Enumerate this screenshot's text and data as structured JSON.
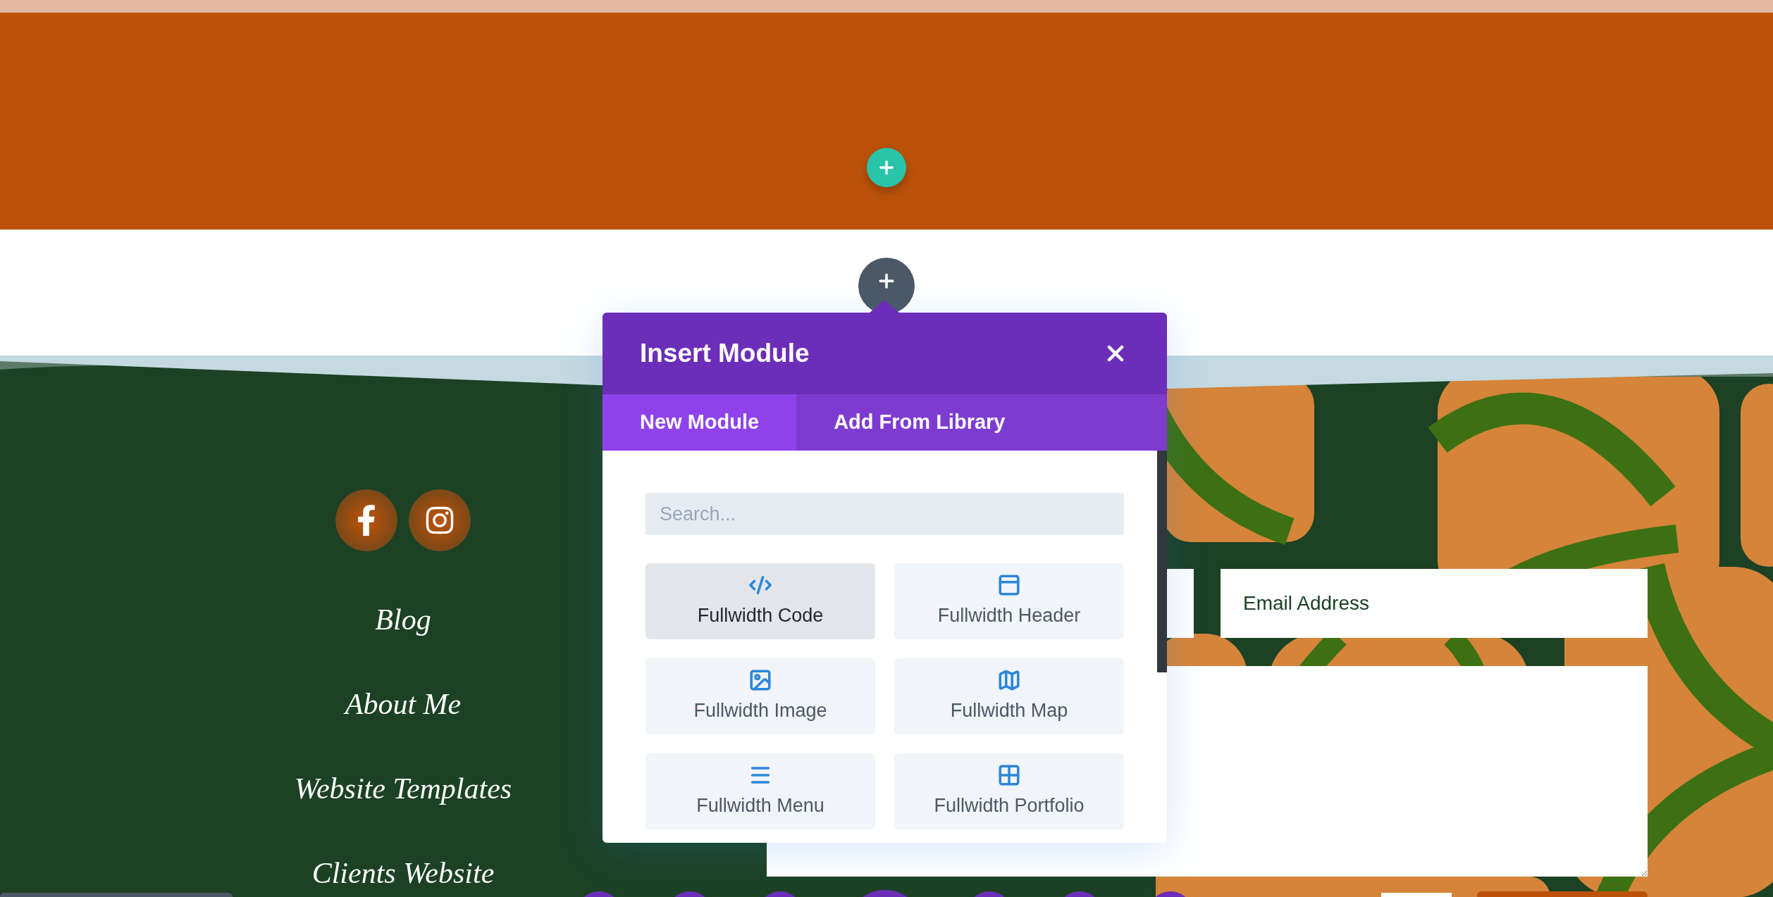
{
  "add_buttons": [
    {
      "kind": "section"
    },
    {
      "kind": "row"
    }
  ],
  "footer": {
    "social": [
      {
        "kind": "facebook"
      },
      {
        "kind": "instagram"
      }
    ],
    "nav": [
      "Blog",
      "About Me",
      "Website Templates",
      "Clients Website"
    ],
    "form": {
      "email_placeholder": "Email Address"
    }
  },
  "modal": {
    "title": "Insert Module",
    "tabs": [
      {
        "label": "New Module",
        "selected": true
      },
      {
        "label": "Add From Library",
        "selected": false
      }
    ],
    "search": {
      "placeholder": "Search..."
    },
    "modules": [
      {
        "label": "Fullwidth Code",
        "kind": "code",
        "selected": true
      },
      {
        "label": "Fullwidth Header",
        "kind": "header",
        "selected": false
      },
      {
        "label": "Fullwidth Image",
        "kind": "image",
        "selected": false
      },
      {
        "label": "Fullwidth Map",
        "kind": "map",
        "selected": false
      },
      {
        "label": "Fullwidth Menu",
        "kind": "menu",
        "selected": false
      },
      {
        "label": "Fullwidth Portfolio",
        "kind": "portfolio",
        "selected": false
      }
    ]
  }
}
